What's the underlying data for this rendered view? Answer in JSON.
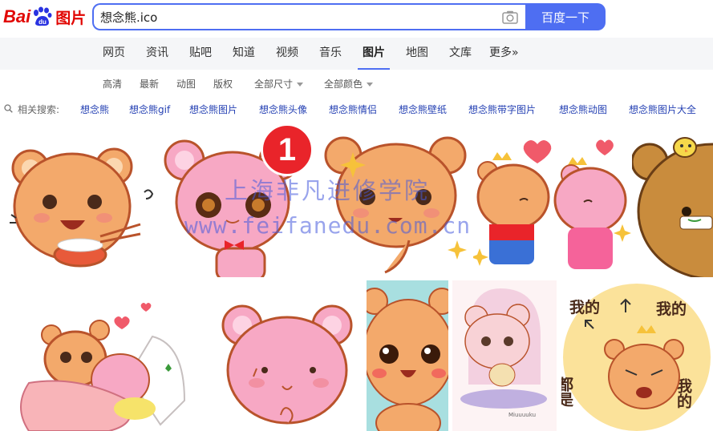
{
  "header": {
    "logo_bai": "Bai",
    "logo_du": "du",
    "logo_product": "图片",
    "search_value": "想念熊.ico",
    "search_button": "百度一下"
  },
  "nav": {
    "items": [
      "网页",
      "资讯",
      "贴吧",
      "知道",
      "视频",
      "音乐",
      "图片",
      "地图",
      "文库",
      "更多»"
    ],
    "active": "图片"
  },
  "filters": {
    "items": [
      "高清",
      "最新",
      "动图",
      "版权"
    ],
    "dropdowns": [
      "全部尺寸",
      "全部颜色"
    ]
  },
  "related": {
    "label": "相关搜索:",
    "links": [
      "想念熊",
      "想念熊gif",
      "想念熊图片",
      "想念熊头像",
      "想念熊情侣",
      "想念熊壁纸",
      "想念熊带字图片",
      "想念熊动图",
      "想念熊图片大全"
    ]
  },
  "results": {
    "badge_number": "1",
    "watermark_line1": "上海非凡进修学院",
    "watermark_line2": "www.feifanedu.com.cn",
    "sticker_text": {
      "wo_de_1": "我的",
      "wo_de_2": "我的",
      "dou_shi": "都是",
      "wo_de_3": "我的",
      "signature": "Miuuuuku"
    }
  },
  "colors": {
    "brand_red": "#e10602",
    "brand_blue": "#4e6ef2",
    "link_blue": "#2440b3",
    "bear_orange": "#f3a96b",
    "bear_pink": "#f7a8c4"
  }
}
